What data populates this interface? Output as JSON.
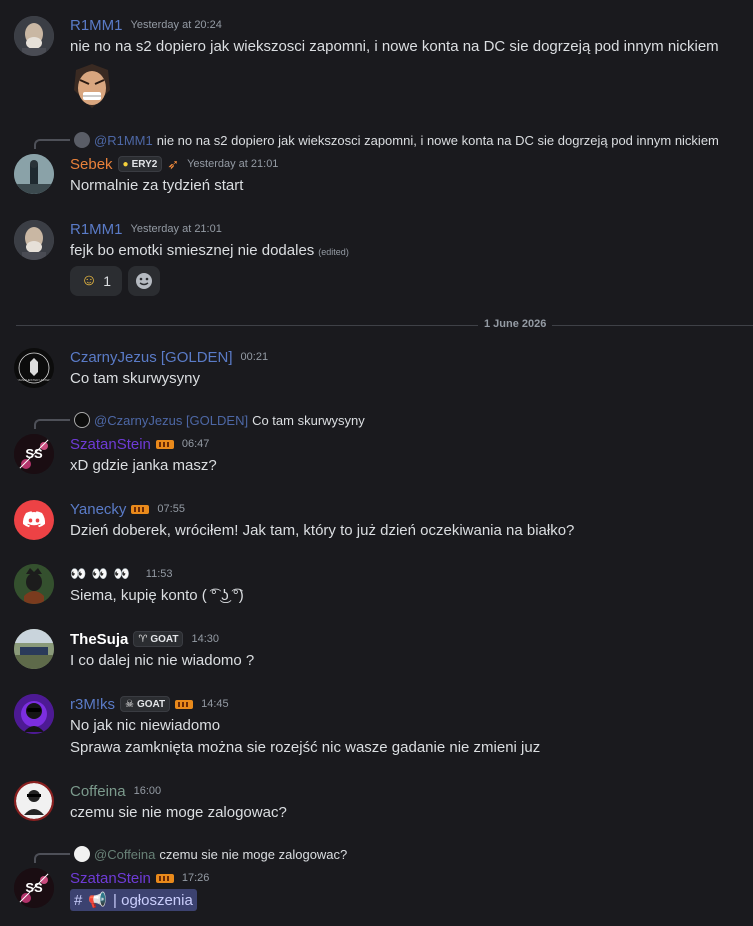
{
  "messages": {
    "m1": {
      "username": "R1MM1",
      "timestamp": "Yesterday at 20:24",
      "content": "nie no na s2 dopiero jak wiekszosci zapomni, i nowe konta na DC sie dogrzeją pod innym nickiem",
      "user_color": "#5a7bc7"
    },
    "m2": {
      "reply": {
        "user": "@R1MM1",
        "text": "nie no na s2 dopiero jak wiekszosci zapomni, i nowe konta na DC sie dogrzeją pod innym nickiem"
      },
      "username": "Sebek",
      "tag": "ERY2",
      "timestamp": "Yesterday at 21:01",
      "content": "Normalnie za tydzień start",
      "user_color": "#e8813a"
    },
    "m3": {
      "username": "R1MM1",
      "timestamp": "Yesterday at 21:01",
      "content": "fejk bo emotki smiesznej nie dodales",
      "edited": "(edited)",
      "reaction_count": "1",
      "user_color": "#5a7bc7"
    },
    "date_divider": "1 June 2026",
    "m4": {
      "username": "CzarnyJezus [GOLDEN]",
      "timestamp": "00:21",
      "content": "Co tam skurwysyny",
      "avatar_text": "MANCHESTER UNITED",
      "user_color": "#5a7bc7"
    },
    "m5": {
      "reply": {
        "user": "@CzarnyJezus [GOLDEN]",
        "text": "Co tam skurwysyny"
      },
      "username": "SzatanStein",
      "timestamp": "06:47",
      "content": "xD gdzie janka masz?",
      "avatar_text": "SS",
      "user_color": "#6e3bd6"
    },
    "m6": {
      "username": "Yanecky",
      "timestamp": "07:55",
      "content": "Dzień doberek, wróciłem! Jak tam, który to już dzień oczekiwania na białko?",
      "user_color": "#5a7bc7"
    },
    "m7": {
      "username": "👀 👀 👀",
      "timestamp": "11:53",
      "content": "Siema, kupię konto ( ͡° ͜ʖ ͡°)"
    },
    "m8": {
      "username": "TheSuja",
      "tag": "GOAT",
      "timestamp": "14:30",
      "content": "I co dalej nic nie wiadomo ?",
      "user_color": "#ffffff"
    },
    "m9": {
      "username": "r3M!ks",
      "tag": "GOAT",
      "timestamp": "14:45",
      "content_line1": "No jak nic niewiadomo",
      "content_line2": "Sprawa zamknięta można sie rozejść nic wasze gadanie nie zmieni juz",
      "user_color": "#5a7bc7"
    },
    "m10": {
      "username": "Coffeina",
      "timestamp": "16:00",
      "content": "czemu sie nie moge zalogowac?",
      "user_color": "#7b9a8c"
    },
    "m11": {
      "reply": {
        "user": "@Coffeina",
        "text": "czemu sie nie moge zalogowac?"
      },
      "username": "SzatanStein",
      "timestamp": "17:26",
      "channel_mention": "| ogłoszenia",
      "avatar_text": "SS",
      "user_color": "#6e3bd6"
    }
  },
  "icons": [
    "grimace-emoji",
    "lemon-icon",
    "rocket-icon",
    "hugging-emoji",
    "add-reaction-icon",
    "discord-logo-icon",
    "eyes-emoji",
    "goat-icon",
    "skull-icon",
    "hash-icon",
    "megaphone-icon"
  ],
  "colors": {
    "background": "#1a1a1e",
    "text": "#dbdee1",
    "muted": "#949ba4",
    "mention_bg": "#3c4270"
  }
}
